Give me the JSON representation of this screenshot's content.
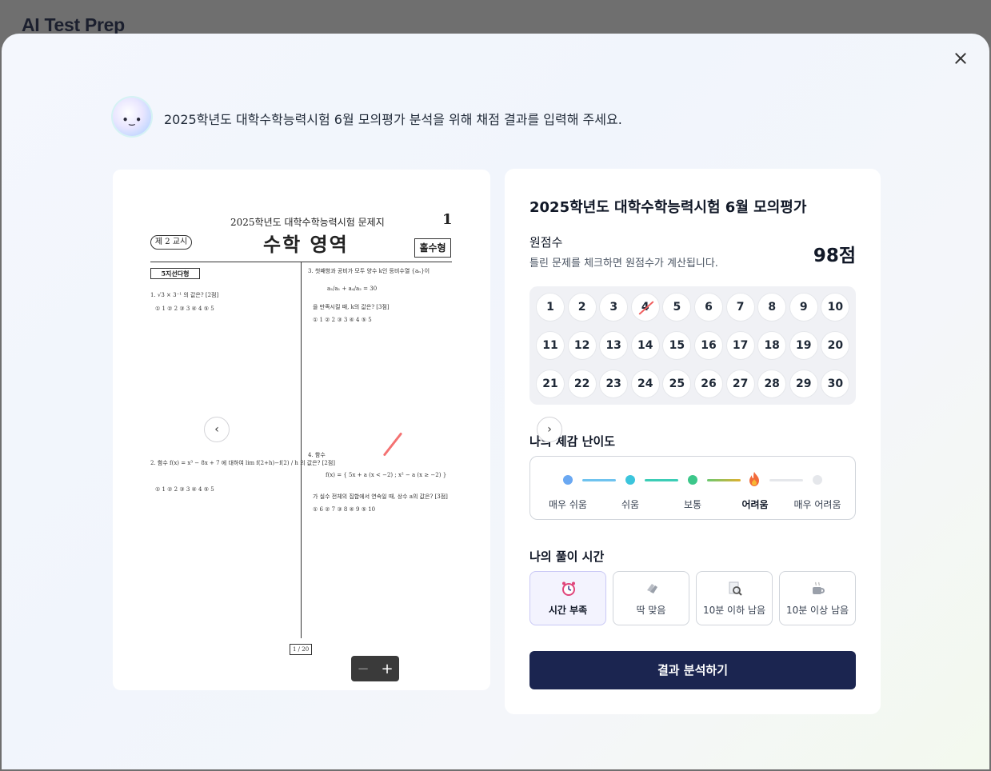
{
  "app": {
    "title": "AI Test Prep"
  },
  "intro": {
    "message": "2025학년도 대학수학능력시험 6월 모의평가 분석을 위해 채점 결과를 입력해 주세요."
  },
  "exam_sheet": {
    "title": "2025학년도 대학수학능력시험 문제지",
    "page_number": "1",
    "session": "제 2 교시",
    "subject": "수학 영역",
    "type": "홀수형",
    "section": "5지선다형",
    "footer_page": "1 / 20",
    "q1": "1. √3 × 3⁻¹ 의 값은? [2점]",
    "q1_opts": "① 1      ② 2      ③ 3      ④ 4      ⑤ 5",
    "q2": "2. 함수 f(x) = x³ − 8x + 7 에 대하여 lim f(2+h)−f(2) / h 의 값은? [2점]",
    "q2_opts": "① 1      ② 2      ③ 3      ④ 4      ⑤ 5",
    "q3": "3. 첫째항과 공비가 모두 양수 k인 등비수열 {aₙ}이",
    "q3_b": "a₂/a₁ + a₄/a₂ = 30",
    "q3_c": "을 만족시킬 때, k의 값은? [3점]",
    "q3_opts": "① 1      ② 2      ③ 3      ④ 4      ⑤ 5",
    "q4": "4. 함수",
    "q4_b": "f(x) = { 5x + a (x < −2) ; x² − a (x ≥ −2) }",
    "q4_c": "가 실수 전체의 집합에서 연속일 때, 상수 a의 값은? [3점]",
    "q4_opts": "① 6      ② 7      ③ 8      ④ 9      ⑤ 10"
  },
  "panel": {
    "exam_title": "2025학년도 대학수학능력시험 6월 모의평가",
    "raw_score_label": "원점수",
    "raw_score_help": "틀린 문제를 체크하면 원점수가 계산됩니다.",
    "raw_score_value": "98점",
    "questions": [
      "1",
      "2",
      "3",
      "4",
      "5",
      "6",
      "7",
      "8",
      "9",
      "10",
      "11",
      "12",
      "13",
      "14",
      "15",
      "16",
      "17",
      "18",
      "19",
      "20",
      "21",
      "22",
      "23",
      "24",
      "25",
      "26",
      "27",
      "28",
      "29",
      "30"
    ],
    "wrong_questions": [
      "4"
    ],
    "difficulty_title": "나의 체감 난이도",
    "difficulty_levels": [
      "매우 쉬움",
      "쉬움",
      "보통",
      "어려움",
      "매우 어려움"
    ],
    "difficulty_selected": "어려움",
    "time_title": "나의 풀이 시간",
    "time_options": [
      "시간 부족",
      "딱 맞음",
      "10분 이하 남음",
      "10분 이상 남음"
    ],
    "time_selected": "시간 부족",
    "analyze_label": "결과 분석하기"
  },
  "colors": {
    "primary_button": "#1b2550",
    "very_easy": "#6aa8f2",
    "easy": "#3cc5dc",
    "normal": "#3cc78a",
    "hard": "#f26a3a",
    "wrong_mark": "#f06060"
  }
}
